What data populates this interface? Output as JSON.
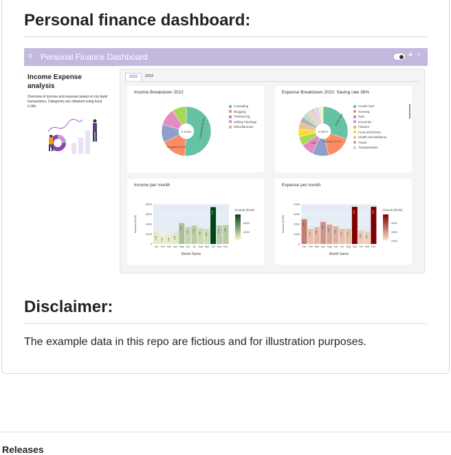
{
  "heading": "Personal finance dashboard:",
  "dashboard": {
    "title": "Personal Finance Dashboard",
    "menu_icon": "≡",
    "sidebar": {
      "title": "Income Expense analysis",
      "description": "Overview of income and expense based on my bank transactions. Categories are obtained using local LLMs."
    },
    "tabs": [
      {
        "label": "2022",
        "active": true
      },
      {
        "label": "2023",
        "active": false
      }
    ],
    "income_breakdown": {
      "title": "Income Breakdown 2022",
      "center_label": "€ 45343",
      "slices": [
        {
          "label": "Consulting",
          "value": 51.0,
          "color": "#66c2a5",
          "text": "Consulting 51.0%"
        },
        {
          "label": "Blogging",
          "value": 16.6,
          "color": "#fc8d62",
          "text": "Blogging 16.6%"
        },
        {
          "label": "Freelancing",
          "value": 12.0,
          "color": "#8da0cb"
        },
        {
          "label": "Selling Paintings",
          "value": 11.0,
          "color": "#e78ac3"
        },
        {
          "label": "Miscellaneous",
          "value": 9.4,
          "color": "#a6d854"
        }
      ]
    },
    "expense_breakdown": {
      "title": "Expense Breakdown 2022: Saving rate 36%",
      "center_label": "€ 28871",
      "legend": [
        {
          "label": "Credit Card",
          "color": "#66c2a5"
        },
        {
          "label": "Housing",
          "color": "#fc8d62"
        },
        {
          "label": "NaN",
          "color": "#8da0cb"
        },
        {
          "label": "Groceries",
          "color": "#e78ac3"
        },
        {
          "label": "Finance",
          "color": "#a6d854"
        },
        {
          "label": "Food and Drinks",
          "color": "#ffd92f"
        },
        {
          "label": "Health and Wellness",
          "color": "#e5c494"
        },
        {
          "label": "Travel",
          "color": "#b3b3b3"
        },
        {
          "label": "Transportation",
          "color": "#b3e2cd"
        }
      ],
      "slice_text": [
        "Credit Card",
        "Housing 16.4%",
        "NaN"
      ],
      "slices": [
        {
          "value": 30,
          "color": "#66c2a5"
        },
        {
          "value": 16.4,
          "color": "#fc8d62"
        },
        {
          "value": 11,
          "color": "#8da0cb"
        },
        {
          "value": 8,
          "color": "#e78ac3"
        },
        {
          "value": 6,
          "color": "#a6d854"
        },
        {
          "value": 5,
          "color": "#ffd92f"
        },
        {
          "value": 4.5,
          "color": "#e5c494"
        },
        {
          "value": 4,
          "color": "#b3b3b3"
        },
        {
          "value": 3.5,
          "color": "#b3e2cd"
        },
        {
          "value": 3,
          "color": "#fdcdac"
        },
        {
          "value": 3,
          "color": "#cbd5e8"
        },
        {
          "value": 2.6,
          "color": "#f4cae4"
        },
        {
          "value": 3,
          "color": "#e6f5c9"
        }
      ]
    },
    "income_per_month": {
      "title": "Income per month",
      "xlabel": "Month Name",
      "ylabel": "Amount (EUR)",
      "colorbar_title": "Amount (EUR)",
      "colorbar_ticks": [
        "6000",
        "4000"
      ],
      "yticks": [
        "8000",
        "6000",
        "4000",
        "2000",
        "0"
      ],
      "ymax": 8000,
      "months": [
        "Jan",
        "Feb",
        "Mar",
        "Apr",
        "May",
        "Jun",
        "Jul",
        "Aug",
        "Sep",
        "Oct",
        "Nov",
        "Dec"
      ],
      "values": [
        2300,
        1900,
        2000,
        2300,
        4200,
        3400,
        3700,
        3200,
        3000,
        7400,
        3700,
        3800
      ],
      "value_labels": [
        "2.3k",
        "1.9k",
        "2.0k",
        "2.3k",
        "4.2k",
        "3.4k",
        "3.7k",
        "3.2k",
        "3.0k",
        "7.4k",
        "3.7k",
        "3.8k"
      ]
    },
    "expense_per_month": {
      "title": "Expense per month",
      "xlabel": "Month Name",
      "ylabel": "Amount (EUR)",
      "colorbar_title": "Amount (EUR)",
      "colorbar_ticks": [
        "4000",
        "3000",
        "2000"
      ],
      "yticks": [
        "4000",
        "3000",
        "2000",
        "1000",
        "0"
      ],
      "ymax": 4500,
      "months": [
        "Jan",
        "Feb",
        "Mar",
        "Apr",
        "May",
        "Jun",
        "Jul",
        "Aug",
        "Sep",
        "Oct",
        "Nov",
        "Dec"
      ],
      "values": [
        2800,
        1700,
        1900,
        2500,
        2200,
        2000,
        1700,
        1700,
        4200,
        1500,
        1400,
        4200
      ],
      "value_labels": [
        "2.8k",
        "1.7k",
        "1.9k",
        "2.5k",
        "2.2k",
        "2.0k",
        "1.7k",
        "1.7k",
        "4.2k",
        "1.5k",
        "1.4k",
        "4.2k"
      ]
    }
  },
  "disclaimer": {
    "heading": "Disclaimer:",
    "text": "The example data in this repo are fictious and for illustration purposes."
  },
  "releases_heading": "Releases"
}
